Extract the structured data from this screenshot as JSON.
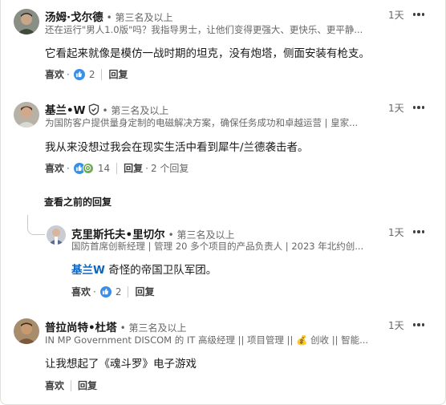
{
  "comments": [
    {
      "name": "汤姆·戈尔德",
      "degree": "• 第三名及以上",
      "headline": "还在运行\"男人1.0版\"吗？我指导男士，让他们变得更强大、更快乐、更平静...",
      "time": "1天",
      "text": "它看起来就像是模仿一战时期的坦克，没有炮塔，侧面安装有枪支。",
      "like_label": "喜欢",
      "reaction_count": "2",
      "reply_label": "回复"
    },
    {
      "name": "基兰•W",
      "degree": "• 第三名及以上",
      "headline": "为国防客户提供量身定制的电磁解决方案，确保任务成功和卓越运营 | 皇家...",
      "time": "1天",
      "text": "我从来没想过我会在现实生活中看到犀牛/兰德袭击者。",
      "like_label": "喜欢",
      "reaction_count": "14",
      "reply_label": "回复",
      "replies_count": "2 个回复"
    },
    {
      "name": "克里斯托夫•里切尔",
      "degree": "• 第三名及以上",
      "headline": "国防首席创新经理 | 管理 20 多个项目的产品负责人 | 2023 年北约创...",
      "time": "1天",
      "mention": "基兰W",
      "text": " 奇怪的帝国卫队军团。",
      "like_label": "喜欢",
      "reaction_count": "2",
      "reply_label": "回复"
    },
    {
      "name": "普拉尚特•杜塔",
      "degree": "• 第三名及以上",
      "headline": "IN MP Government DISCOM 的 IT 高级经理 || 项目管理 || 💰 创收 || 智能...",
      "time": "1天",
      "text": "让我想起了《魂斗罗》电子游戏",
      "like_label": "喜欢",
      "reply_label": "回复"
    }
  ],
  "load_previous_label": "查看之前的回复",
  "colors": {
    "like_blue": "#378fe9",
    "support_green": "#44712e",
    "mention": "#0a66c2"
  }
}
